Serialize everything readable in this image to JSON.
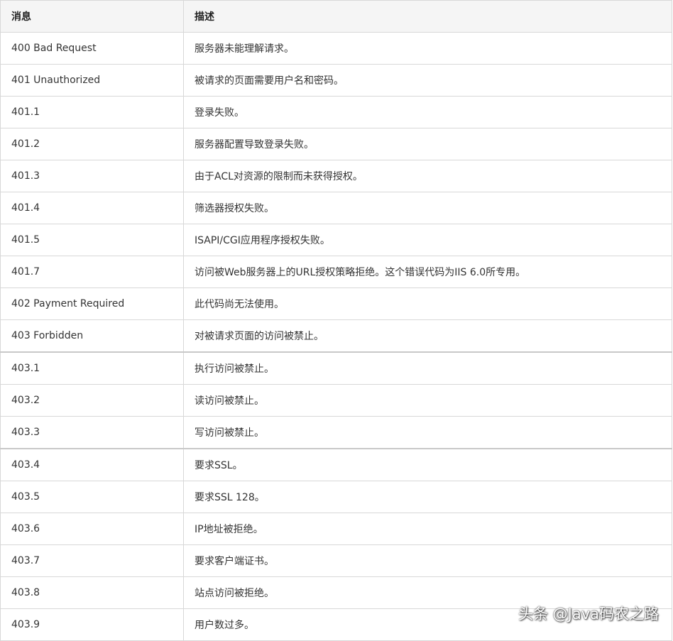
{
  "table": {
    "headers": [
      "消息",
      "描述"
    ],
    "rows": [
      {
        "message": "400 Bad Request",
        "description": "服务器未能理解请求。"
      },
      {
        "message": "401 Unauthorized",
        "description": "被请求的页面需要用户名和密码。"
      },
      {
        "message": "401.1",
        "description": "登录失败。"
      },
      {
        "message": "401.2",
        "description": "服务器配置导致登录失败。"
      },
      {
        "message": "401.3",
        "description": "由于ACL对资源的限制而未获得授权。"
      },
      {
        "message": "401.4",
        "description": "筛选器授权失败。"
      },
      {
        "message": "401.5",
        "description": "ISAPI/CGI应用程序授权失败。"
      },
      {
        "message": "401.7",
        "description": "访问被Web服务器上的URL授权策略拒绝。这个错误代码为IIS 6.0所专用。"
      },
      {
        "message": "402 Payment Required",
        "description": "此代码尚无法使用。"
      },
      {
        "message": "403 Forbidden",
        "description": "对被请求页面的访问被禁止。"
      },
      {
        "message": "403.1",
        "description": "执行访问被禁止。"
      },
      {
        "message": "403.2",
        "description": "读访问被禁止。"
      },
      {
        "message": "403.3",
        "description": "写访问被禁止。"
      },
      {
        "message": "403.4",
        "description": "要求SSL。"
      },
      {
        "message": "403.5",
        "description": "要求SSL 128。"
      },
      {
        "message": "403.6",
        "description": "IP地址被拒绝。"
      },
      {
        "message": "403.7",
        "description": "要求客户端证书。"
      },
      {
        "message": "403.8",
        "description": "站点访问被拒绝。"
      },
      {
        "message": "403.9",
        "description": "用户数过多。"
      }
    ]
  },
  "watermark": "头条 @Java码农之路"
}
